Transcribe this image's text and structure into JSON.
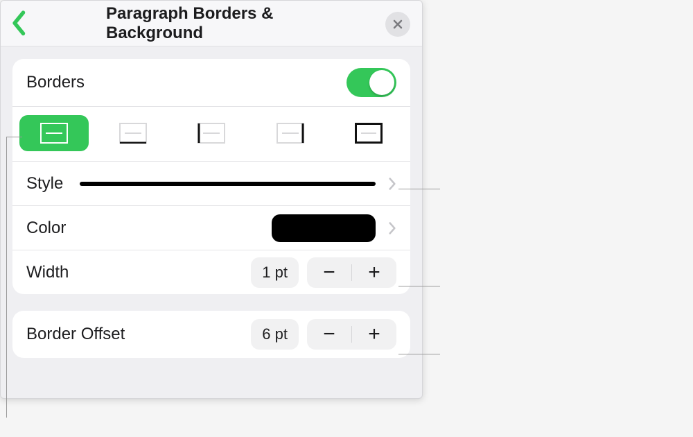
{
  "header": {
    "title": "Paragraph Borders & Background"
  },
  "borders": {
    "label": "Borders",
    "toggle_on": true
  },
  "style": {
    "label": "Style"
  },
  "color": {
    "label": "Color",
    "hex": "#000000"
  },
  "width": {
    "label": "Width",
    "value": "1 pt"
  },
  "offset": {
    "label": "Border Offset",
    "value": "6 pt"
  },
  "segments": [
    {
      "name": "border-all",
      "active": true
    },
    {
      "name": "border-bottom",
      "active": false
    },
    {
      "name": "border-left",
      "active": false
    },
    {
      "name": "border-right",
      "active": false
    },
    {
      "name": "border-outside",
      "active": false
    }
  ]
}
